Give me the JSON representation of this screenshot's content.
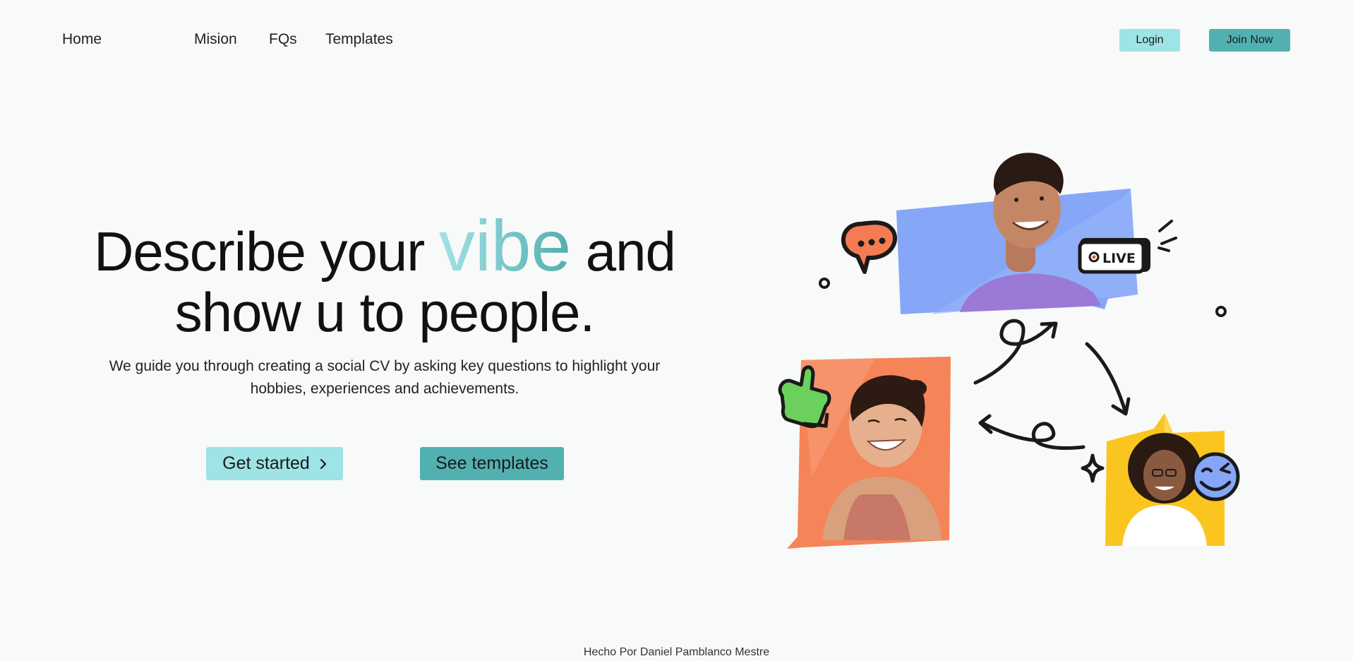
{
  "nav": {
    "home": "Home",
    "mision": "Mision",
    "fqs": "FQs",
    "templates": "Templates",
    "login": "Login",
    "join": "Join Now"
  },
  "hero": {
    "title_part1": "Describe your ",
    "title_highlight": "vibe",
    "title_part2": " and show u to people.",
    "subtitle": "We guide you through creating a social CV by asking key questions to highlight your hobbies, experiences and achievements.",
    "cta_primary": "Get started",
    "cta_primary_icon": "chevron-right-icon",
    "cta_secondary": "See templates"
  },
  "illustration": {
    "live_badge": "LIVE",
    "icons": [
      "chat-bubble-icon",
      "live-badge-icon",
      "thumbs-up-icon",
      "wink-smiley-icon",
      "sparkle-icon",
      "curly-arrow-icon"
    ]
  },
  "footer": {
    "credit": "Hecho Por Daniel Pamblanco Mestre"
  },
  "colors": {
    "accent_light": "#9ee3e5",
    "accent_dark": "#52b1b0",
    "background": "#f8f9f9"
  }
}
